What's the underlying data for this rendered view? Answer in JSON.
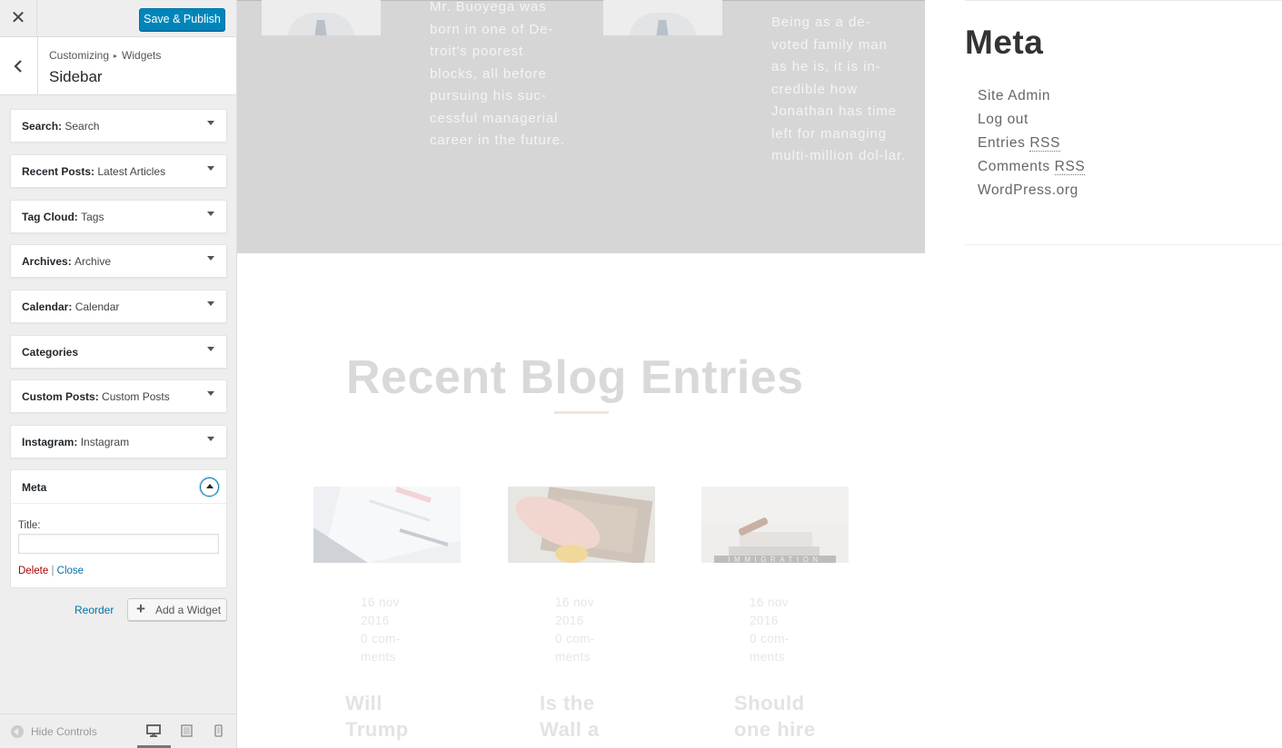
{
  "customizer": {
    "close_icon": "close-icon",
    "publish_label": "Save & Publish",
    "breadcrumb": [
      "Customizing",
      "Widgets"
    ],
    "section_title": "Sidebar",
    "widgets": [
      {
        "type": "Search",
        "sub": "Search"
      },
      {
        "type": "Recent Posts",
        "sub": "Latest Articles"
      },
      {
        "type": "Tag Cloud",
        "sub": "Tags"
      },
      {
        "type": "Archives",
        "sub": "Archive"
      },
      {
        "type": "Calendar",
        "sub": "Calendar"
      },
      {
        "type": "Categories",
        "sub": ""
      },
      {
        "type": "Custom Posts",
        "sub": "Custom Posts"
      },
      {
        "type": "Instagram",
        "sub": "Instagram"
      }
    ],
    "meta_widget": {
      "title": "Meta",
      "field_label": "Title:",
      "field_value": "",
      "delete_label": "Delete",
      "separator": "|",
      "close_label": "Close"
    },
    "reorder_label": "Reorder",
    "add_widget_label": "Add a Widget",
    "hide_controls_label": "Hide Controls",
    "devices": [
      "desktop-icon",
      "tablet-icon",
      "mobile-icon"
    ],
    "accent_color": "#0085ba"
  },
  "preview": {
    "bio_1": "Mr. Buoyega was born in one of De-troit's poorest blocks, all before pursuing his suc-cessful managerial career in the future.",
    "bio_2": "Being as a de-voted family man as he is, it is in-credible how Jonathan has time left for managing multi-million dol-lar.",
    "meta_heading": "Meta",
    "meta_links": [
      "Site Admin",
      "Log out",
      "Entries",
      "Comments",
      "WordPress.org"
    ],
    "rss_abbr": "RSS",
    "blog_heading": "Recent Blog Entries",
    "posts": [
      {
        "date_1": "16 nov",
        "date_2": "2016",
        "comments_1": "0 com-",
        "comments_2": "ments",
        "title_1": "Will",
        "title_2": "Trump"
      },
      {
        "date_1": "16 nov",
        "date_2": "2016",
        "comments_1": "0 com-",
        "comments_2": "ments",
        "title_1": "Is the",
        "title_2": "Wall a"
      },
      {
        "date_1": "16 nov",
        "date_2": "2016",
        "comments_1": "0 com-",
        "comments_2": "ments",
        "title_1": "Should",
        "title_2": "one hire"
      }
    ],
    "thumb_3_caption": "IMMIGRATION"
  }
}
